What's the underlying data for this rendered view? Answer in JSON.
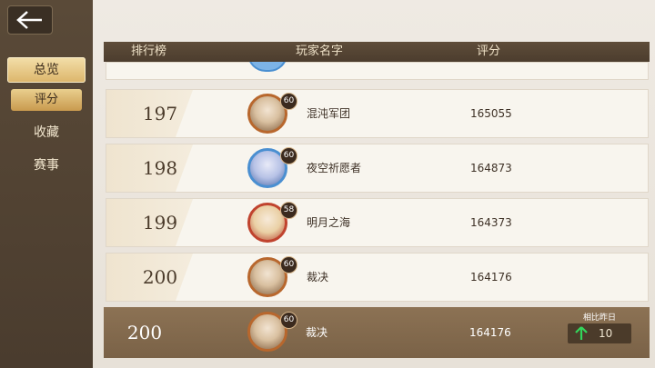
{
  "header": {
    "rank": "排行榜",
    "player": "玩家名字",
    "score": "评分"
  },
  "sidebar": {
    "main": "总览",
    "sub": "评分",
    "collection": "收藏",
    "events": "赛事"
  },
  "rows": [
    {
      "rank": "197",
      "level": "60",
      "name": "混沌军团",
      "score": "165055"
    },
    {
      "rank": "198",
      "level": "60",
      "name": "夜空祈愿者",
      "score": "164873"
    },
    {
      "rank": "199",
      "level": "58",
      "name": "明月之海",
      "score": "164373"
    },
    {
      "rank": "200",
      "level": "60",
      "name": "裁决",
      "score": "164176"
    }
  ],
  "self": {
    "rank": "200",
    "level": "60",
    "name": "裁决",
    "score": "164176",
    "compare_label": "相比昨日",
    "compare_value": "10"
  },
  "icons": {
    "back": "arrow-left-icon",
    "up": "arrow-up-icon"
  }
}
